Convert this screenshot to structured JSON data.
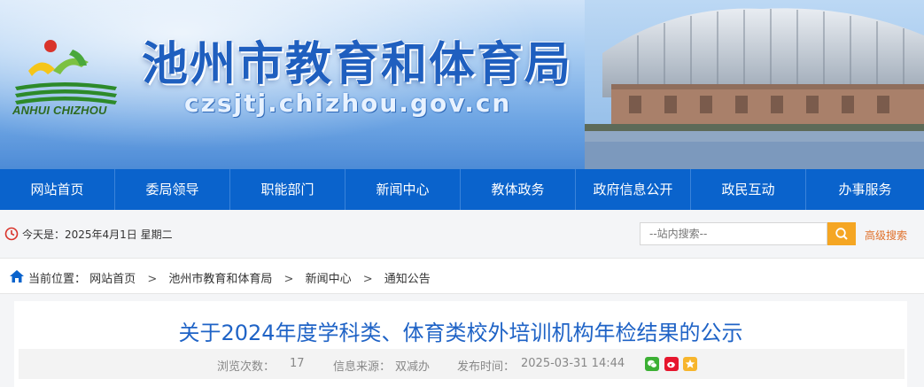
{
  "header": {
    "site_title": "池州市教育和体育局",
    "site_url": "czsjtj.chizhou.gov.cn",
    "logo_caption": "ANHUI CHIZHOU"
  },
  "nav": {
    "items": [
      "网站首页",
      "委局领导",
      "职能部门",
      "新闻中心",
      "教体政务",
      "政府信息公开",
      "政民互动",
      "办事服务"
    ]
  },
  "utility": {
    "date_text": "今天是：2025年4月1日 星期二",
    "search_placeholder": "--站内搜索--",
    "advanced_search": "高级搜索"
  },
  "breadcrumb": {
    "label": "当前位置：",
    "items": [
      "网站首页",
      "池州市教育和体育局",
      "新闻中心",
      "通知公告"
    ],
    "separator": ">"
  },
  "article": {
    "title": "关于2024年度学科类、体育类校外培训机构年检结果的公示",
    "views_label": "浏览次数：",
    "views": "17",
    "source_label": "信息来源：",
    "source": "双减办",
    "date_label": "发布时间：",
    "date": "2025-03-31 14:44",
    "share_icons": [
      "wechat-icon",
      "weibo-icon",
      "qzone-icon"
    ]
  },
  "colors": {
    "nav_bg": "#0a63cc",
    "title_blue": "#1f63c6",
    "search_btn": "#f5a623",
    "adv_search": "#e0702a"
  }
}
